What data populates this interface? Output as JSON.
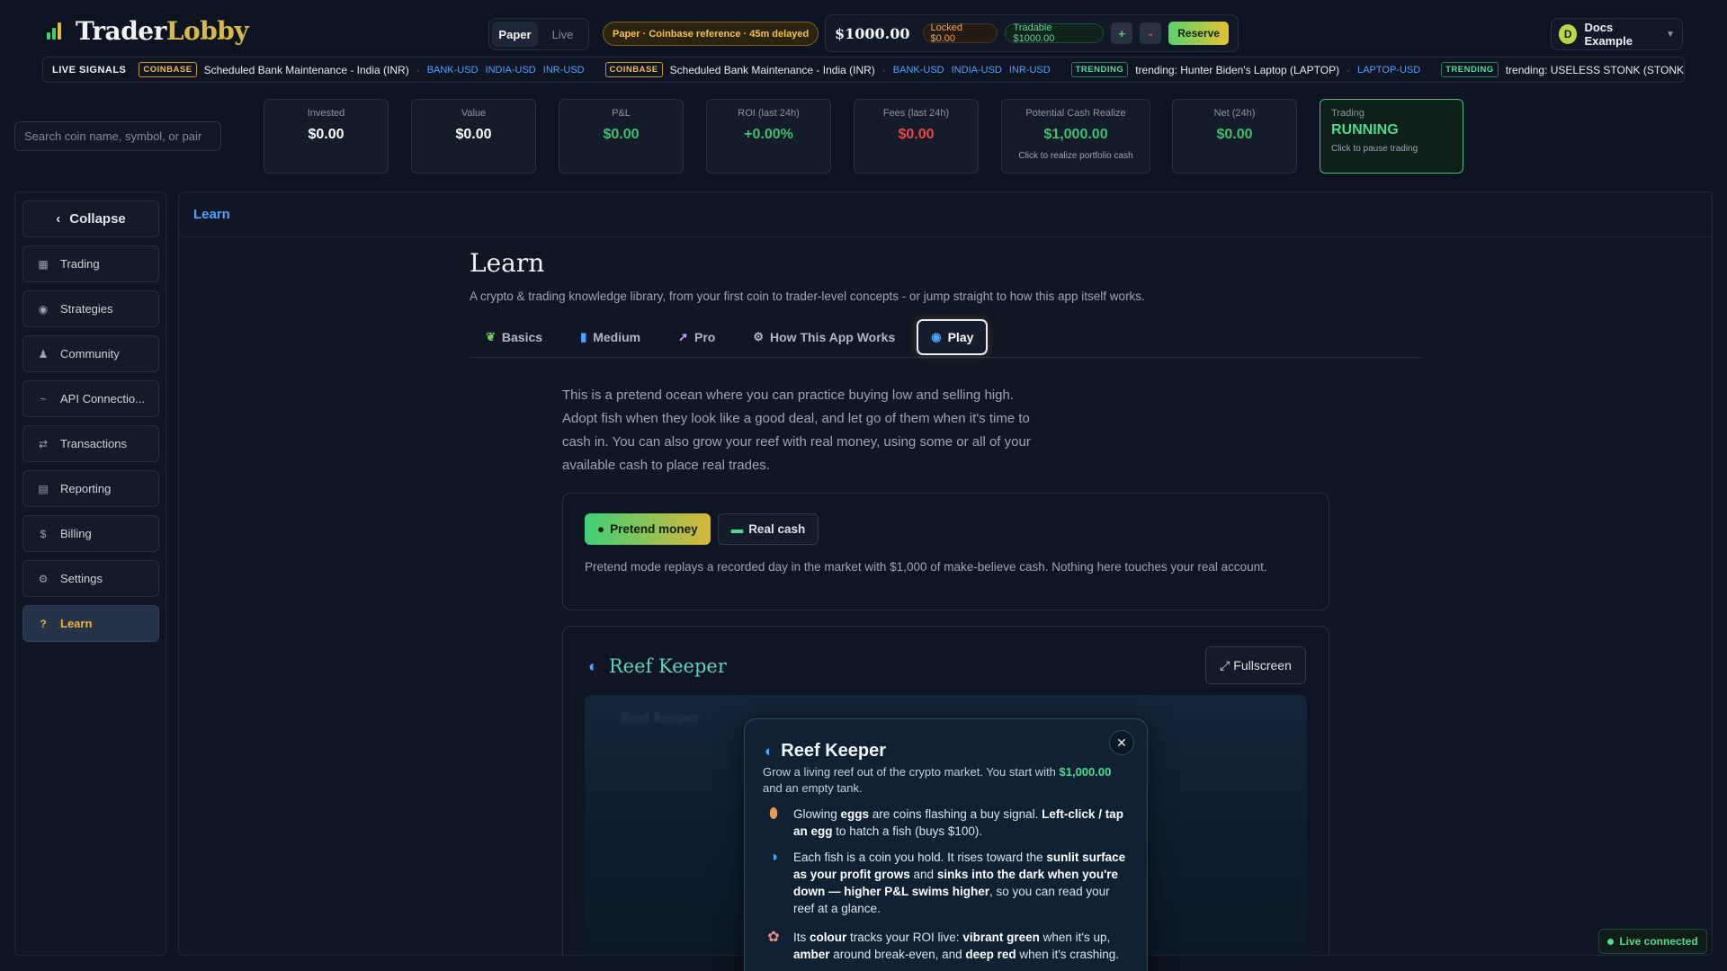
{
  "app": {
    "logo_part1": "Trader",
    "logo_part2": "Lobby"
  },
  "topbar": {
    "mode_paper": "Paper",
    "mode_live": "Live",
    "paper_badge": "Paper · Coinbase reference · 45m delayed",
    "balance": "$1000.00",
    "locked": "Locked $0.00",
    "tradable": "Tradable $1000.00",
    "plus": "+",
    "minus": "-",
    "reserve": "Reserve",
    "user_initial": "D",
    "user_name": "Docs Example"
  },
  "ticker": {
    "label": "LIVE SIGNALS",
    "items": [
      {
        "tag": "COINBASE",
        "text": "Scheduled Bank Maintenance - India (INR)",
        "symbols": [
          "BANK-USD",
          "INDIA-USD",
          "INR-USD"
        ]
      },
      {
        "tag": "COINBASE",
        "text": "Scheduled Bank Maintenance - India (INR)",
        "symbols": [
          "BANK-USD",
          "INDIA-USD",
          "INR-USD"
        ]
      },
      {
        "tag": "TRENDING",
        "text": "trending: Hunter Biden's Laptop (LAPTOP)",
        "symbols": [
          "LAPTOP-USD"
        ]
      },
      {
        "tag": "TRENDING",
        "text": "trending: USELESS STONK (STONK",
        "symbols": []
      }
    ]
  },
  "search": {
    "placeholder": "Search coin name, symbol, or pair"
  },
  "stats": {
    "invested": {
      "label": "Invested",
      "value": "$0.00"
    },
    "value": {
      "label": "Value",
      "value": "$0.00"
    },
    "pnl": {
      "label": "P&L",
      "value": "$0.00"
    },
    "roi": {
      "label": "ROI (last 24h)",
      "value": "+0.00%"
    },
    "fees": {
      "label": "Fees (last 24h)",
      "value": "$0.00"
    },
    "cash_realize": {
      "label": "Potential Cash Realize",
      "value": "$1,000.00",
      "sub": "Click to realize portfolio cash"
    },
    "net": {
      "label": "Net (24h)",
      "value": "$0.00"
    },
    "trading": {
      "label": "Trading",
      "value": "RUNNING",
      "sub": "Click to pause trading"
    }
  },
  "sidebar": {
    "collapse": "Collapse",
    "items": [
      {
        "label": "Trading",
        "icon": "grid-icon"
      },
      {
        "label": "Strategies",
        "icon": "target-icon"
      },
      {
        "label": "Community",
        "icon": "bell-icon"
      },
      {
        "label": "API Connectio...",
        "icon": "plug-icon"
      },
      {
        "label": "Transactions",
        "icon": "swap-icon"
      },
      {
        "label": "Reporting",
        "icon": "report-icon"
      },
      {
        "label": "Billing",
        "icon": "dollar-icon"
      },
      {
        "label": "Settings",
        "icon": "gear-icon"
      },
      {
        "label": "Learn",
        "icon": "question-icon"
      }
    ]
  },
  "main": {
    "breadcrumb": "Learn",
    "title": "Learn",
    "description": "A crypto & trading knowledge library, from your first coin to trader-level concepts - or jump straight to how this app itself works.",
    "tabs": [
      {
        "label": "Basics",
        "icon": "sprout-icon"
      },
      {
        "label": "Medium",
        "icon": "book-icon"
      },
      {
        "label": "Pro",
        "icon": "rocket-icon"
      },
      {
        "label": "How This App Works",
        "icon": "gear-icon"
      },
      {
        "label": "Play",
        "icon": "fish-icon"
      }
    ],
    "active_tab": "Play",
    "intro": "This is a pretend ocean where you can practice buying low and selling high. Adopt fish when they look like a good deal, and let go of them when it's time to cash in. You can also grow your reef with real money, using some or all of your available cash to place real trades.",
    "money": {
      "pretend": "Pretend money",
      "real": "Real cash",
      "note": "Pretend mode replays a recorded day in the market with $1,000 of make-believe cash. Nothing here touches your real account."
    },
    "game": {
      "title": "Reef Keeper",
      "fullscreen": "Fullscreen",
      "modal": {
        "title": "Reef Keeper",
        "sub_pre": "Grow a living reef out of the crypto market. You start with ",
        "sub_money": "$1,000.00",
        "sub_post": " and an empty tank.",
        "rows": [
          {
            "icon": "egg-icon",
            "pre": "Glowing ",
            "b1": "eggs",
            "mid1": " are coins flashing a buy signal. ",
            "b2": "Left-click / tap an egg",
            "post": " to hatch a fish (buys $100)."
          },
          {
            "icon": "fish-icon",
            "pre": "Each fish is a coin you hold. It rises toward the ",
            "b1": "sunlit surface as your profit grows",
            "mid1": " and ",
            "b2": "sinks into the dark when you're down — higher P&L swims higher",
            "post": ", so you can read your reef at a glance."
          },
          {
            "icon": "palette-icon",
            "pre": "Its ",
            "b1": "colour",
            "mid1": " tracks your ROI live: ",
            "b2": "vibrant green",
            "post": " when it's up,"
          },
          {
            "icon": "",
            "pre": "",
            "b1": "amber",
            "mid1": " around break-even, and ",
            "b2": "deep red",
            "post": " when it's crashing."
          }
        ]
      }
    }
  },
  "status": {
    "live": "Live connected"
  },
  "colors": {
    "accent": "#f0b43c",
    "positive": "#3fbf6f",
    "negative": "#ee4545",
    "link": "#4ea3ff"
  }
}
